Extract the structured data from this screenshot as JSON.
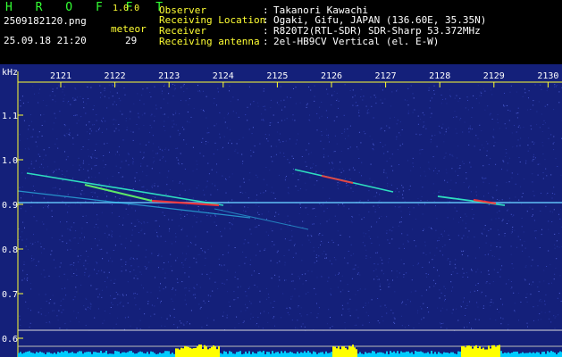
{
  "app": {
    "name": "H R O F F T",
    "version": "1.0.0",
    "filename": "2509182120.png",
    "datetime": "25.09.18 21:20",
    "meteor_label": "meteor",
    "meteor_count": "29"
  },
  "info": {
    "rows": [
      {
        "label": "Observer",
        "sep": ":",
        "value": "Takanori Kawachi"
      },
      {
        "label": "Receiving Location",
        "sep": ":",
        "value": "Ogaki, Gifu, JAPAN (136.60E, 35.35N)"
      },
      {
        "label": "Receiver",
        "sep": ":",
        "value": "R820T2(RTL-SDR) SDR-Sharp 53.372MHz"
      },
      {
        "label": "Receiving antenna",
        "sep": ":",
        "value": "2el-HB9CV Vertical (el. E-W)"
      }
    ]
  },
  "waterfall": {
    "unit_label": "kHz",
    "time_ticks": [
      "2121",
      "2122",
      "2123",
      "2124",
      "2125",
      "2126",
      "2127",
      "2128",
      "2129",
      "2130"
    ],
    "freq_ticks": [
      "1.1",
      "1.0",
      "0.9",
      "0.8",
      "0.7",
      "0.6"
    ],
    "colors": {
      "background": "#14207a",
      "axis": "#ffff33",
      "signal": "#33ffcc",
      "peak": "#ff3333",
      "level": "#00ccff",
      "level_peak": "#ffff00"
    }
  }
}
